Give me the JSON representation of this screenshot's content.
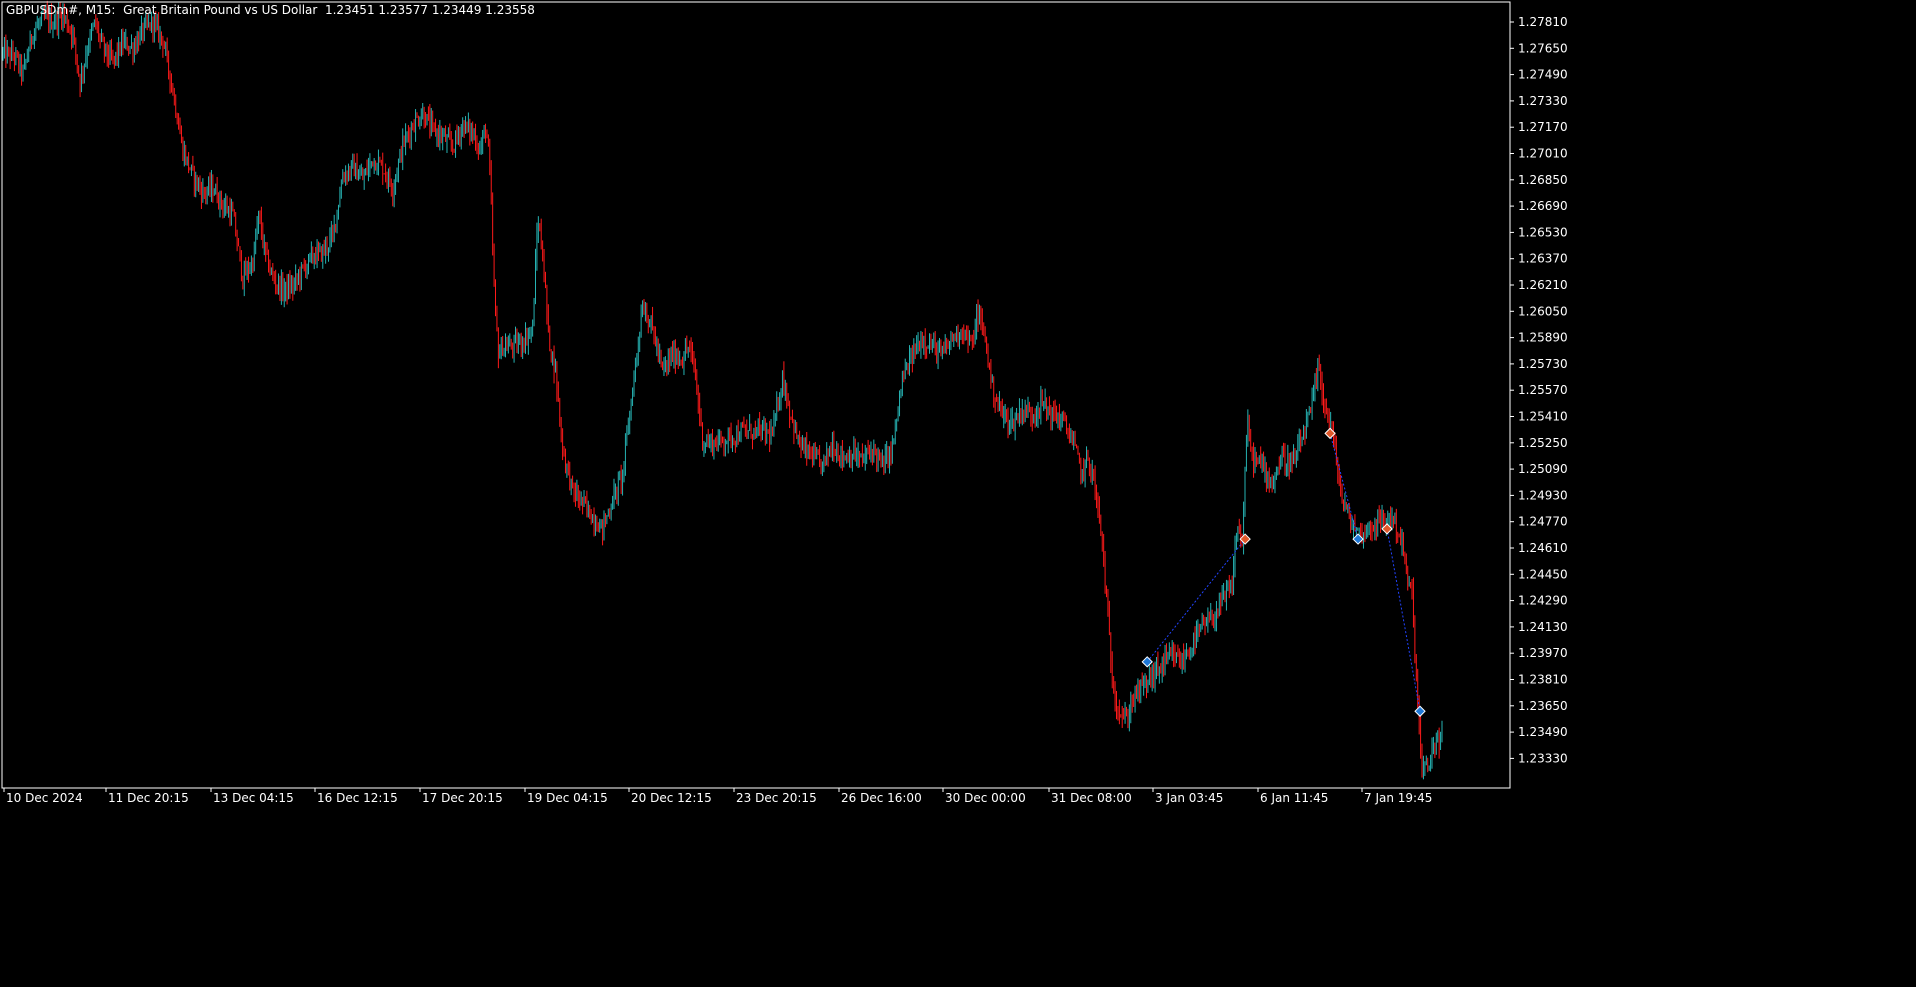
{
  "window": {
    "symbol": "GBPUSDm#",
    "timeframe": "M15",
    "description": "Great Britain Pound vs US Dollar",
    "ohlc": [
      "1.23451",
      "1.23577",
      "1.23449",
      "1.23558"
    ],
    "title_text": "GBPUSDm#, M15:  Great Britain Pound vs US Dollar  1.23451 1.23577 1.23449 1.23558"
  },
  "colors": {
    "background": "#000000",
    "frame": "#ffffff",
    "bull_candle": "#26b3b3",
    "bear_candle": "#ff1a1a",
    "marker_buy": "#1e78d7",
    "marker_sell": "#e0582a",
    "trade_line": "#2244ff",
    "text": "#ffffff"
  },
  "chart_data": {
    "type": "candlestick",
    "title": "GBPUSDm#, M15:  Great Britain Pound vs US Dollar",
    "x_tick_labels": [
      "10 Dec 2024",
      "11 Dec 20:15",
      "13 Dec 04:15",
      "16 Dec 12:15",
      "17 Dec 20:15",
      "19 Dec 04:15",
      "20 Dec 12:15",
      "23 Dec 20:15",
      "26 Dec 16:00",
      "30 Dec 00:00",
      "31 Dec 08:00",
      "3 Jan 03:45",
      "6 Jan 11:45",
      "7 Jan 19:45"
    ],
    "y_tick_labels": [
      "1.27810",
      "1.27650",
      "1.27490",
      "1.27330",
      "1.27170",
      "1.27010",
      "1.26850",
      "1.26690",
      "1.26530",
      "1.26370",
      "1.26210",
      "1.26050",
      "1.25890",
      "1.25730",
      "1.25570",
      "1.25410",
      "1.25250",
      "1.25090",
      "1.24930",
      "1.24770",
      "1.24610",
      "1.24450",
      "1.24290",
      "1.24130",
      "1.23970",
      "1.23810",
      "1.23650",
      "1.23490",
      "1.23330"
    ],
    "ylim": [
      1.2326,
      1.2787
    ],
    "grid": false,
    "price_path": [
      [
        0.0,
        1.2757
      ],
      [
        1.2,
        1.2755
      ],
      [
        2.0,
        1.2745
      ],
      [
        3.0,
        1.277
      ],
      [
        4.2,
        1.2778
      ],
      [
        5.0,
        1.2775
      ],
      [
        6.0,
        1.278
      ],
      [
        7.0,
        1.2768
      ],
      [
        7.7,
        1.274
      ],
      [
        8.5,
        1.2762
      ],
      [
        9.2,
        1.2775
      ],
      [
        10.0,
        1.276
      ],
      [
        11.0,
        1.2752
      ],
      [
        12.0,
        1.2763
      ],
      [
        13.0,
        1.276
      ],
      [
        14.0,
        1.277
      ],
      [
        15.0,
        1.2775
      ],
      [
        16.0,
        1.2765
      ],
      [
        17.0,
        1.2735
      ],
      [
        18.0,
        1.27
      ],
      [
        19.0,
        1.2685
      ],
      [
        20.0,
        1.2675
      ],
      [
        21.0,
        1.2678
      ],
      [
        22.0,
        1.2668
      ],
      [
        23.0,
        1.2662
      ],
      [
        24.0,
        1.2625
      ],
      [
        25.0,
        1.2635
      ],
      [
        25.6,
        1.2662
      ],
      [
        26.2,
        1.264
      ],
      [
        27.0,
        1.2625
      ],
      [
        28.0,
        1.2618
      ],
      [
        29.0,
        1.262
      ],
      [
        30.0,
        1.263
      ],
      [
        31.0,
        1.2638
      ],
      [
        32.0,
        1.264
      ],
      [
        33.0,
        1.265
      ],
      [
        34.0,
        1.2685
      ],
      [
        35.0,
        1.269
      ],
      [
        36.0,
        1.2683
      ],
      [
        37.0,
        1.2695
      ],
      [
        38.0,
        1.269
      ],
      [
        39.0,
        1.2678
      ],
      [
        40.0,
        1.2703
      ],
      [
        41.0,
        1.2715
      ],
      [
        42.0,
        1.2722
      ],
      [
        43.0,
        1.2712
      ],
      [
        44.0,
        1.2708
      ],
      [
        45.0,
        1.2702
      ],
      [
        46.0,
        1.2715
      ],
      [
        47.0,
        1.271
      ],
      [
        47.8,
        1.27
      ],
      [
        48.3,
        1.2715
      ],
      [
        48.7,
        1.269
      ],
      [
        49.2,
        1.261
      ],
      [
        49.6,
        1.258
      ],
      [
        50.0,
        1.2585
      ],
      [
        51.0,
        1.2585
      ],
      [
        52.0,
        1.2588
      ],
      [
        53.0,
        1.2595
      ],
      [
        53.5,
        1.266
      ],
      [
        54.0,
        1.264
      ],
      [
        54.6,
        1.259
      ],
      [
        55.3,
        1.257
      ],
      [
        56.0,
        1.2525
      ],
      [
        57.0,
        1.25
      ],
      [
        58.0,
        1.2493
      ],
      [
        59.0,
        1.2485
      ],
      [
        60.0,
        1.2478
      ],
      [
        61.0,
        1.2495
      ],
      [
        62.0,
        1.251
      ],
      [
        63.0,
        1.256
      ],
      [
        64.0,
        1.261
      ],
      [
        65.0,
        1.2595
      ],
      [
        66.0,
        1.257
      ],
      [
        67.0,
        1.258
      ],
      [
        68.0,
        1.2578
      ],
      [
        68.6,
        1.2585
      ],
      [
        69.2,
        1.2572
      ],
      [
        70.0,
        1.253
      ],
      [
        71.0,
        1.2528
      ],
      [
        72.0,
        1.253
      ],
      [
        73.0,
        1.2532
      ],
      [
        74.0,
        1.2535
      ],
      [
        75.0,
        1.2535
      ],
      [
        76.0,
        1.2535
      ],
      [
        77.0,
        1.2533
      ],
      [
        78.0,
        1.2567
      ],
      [
        78.7,
        1.2548
      ],
      [
        79.5,
        1.253
      ],
      [
        80.0,
        1.2525
      ],
      [
        81.0,
        1.252
      ],
      [
        82.0,
        1.2515
      ],
      [
        83.0,
        1.2528
      ],
      [
        84.0,
        1.252
      ],
      [
        85.0,
        1.2522
      ],
      [
        86.0,
        1.2518
      ],
      [
        87.0,
        1.2525
      ],
      [
        88.0,
        1.2515
      ],
      [
        89.0,
        1.2525
      ],
      [
        90.0,
        1.2565
      ],
      [
        91.0,
        1.258
      ],
      [
        92.0,
        1.259
      ],
      [
        93.0,
        1.2585
      ],
      [
        94.0,
        1.258
      ],
      [
        95.0,
        1.259
      ],
      [
        96.0,
        1.2595
      ],
      [
        97.0,
        1.2585
      ],
      [
        97.5,
        1.2605
      ],
      [
        98.3,
        1.259
      ],
      [
        99.0,
        1.256
      ],
      [
        100.0,
        1.2545
      ],
      [
        101.0,
        1.254
      ],
      [
        102.0,
        1.2548
      ],
      [
        103.0,
        1.2545
      ],
      [
        104.0,
        1.2552
      ],
      [
        105.0,
        1.2545
      ],
      [
        106.0,
        1.2542
      ],
      [
        107.0,
        1.253
      ],
      [
        108.0,
        1.251
      ],
      [
        108.6,
        1.252
      ],
      [
        109.2,
        1.2505
      ],
      [
        110.0,
        1.247
      ],
      [
        110.5,
        1.243
      ],
      [
        111.0,
        1.239
      ],
      [
        111.6,
        1.2372
      ],
      [
        112.4,
        1.2365
      ],
      [
        113.0,
        1.2378
      ],
      [
        114.0,
        1.2385
      ],
      [
        115.0,
        1.2392
      ],
      [
        116.0,
        1.2398
      ],
      [
        117.0,
        1.2403
      ],
      [
        118.0,
        1.24
      ],
      [
        119.0,
        1.241
      ],
      [
        120.0,
        1.242
      ],
      [
        121.0,
        1.2425
      ],
      [
        122.0,
        1.2435
      ],
      [
        123.0,
        1.2445
      ],
      [
        123.5,
        1.248
      ],
      [
        124.0,
        1.247
      ],
      [
        124.5,
        1.254
      ],
      [
        125.0,
        1.252
      ],
      [
        126.0,
        1.2515
      ],
      [
        127.0,
        1.2505
      ],
      [
        128.0,
        1.252
      ],
      [
        129.0,
        1.2515
      ],
      [
        130.0,
        1.253
      ],
      [
        131.0,
        1.255
      ],
      [
        131.6,
        1.2573
      ],
      [
        132.3,
        1.255
      ],
      [
        133.0,
        1.2535
      ],
      [
        134.0,
        1.2495
      ],
      [
        135.0,
        1.248
      ],
      [
        136.0,
        1.2475
      ],
      [
        137.0,
        1.248
      ],
      [
        138.0,
        1.2482
      ],
      [
        139.0,
        1.2485
      ],
      [
        140.0,
        1.247
      ],
      [
        140.6,
        1.2445
      ],
      [
        141.0,
        1.244
      ],
      [
        141.5,
        1.2382
      ],
      [
        142.0,
        1.2335
      ],
      [
        142.6,
        1.2338
      ],
      [
        143.2,
        1.2352
      ],
      [
        144.0,
        1.2355
      ]
    ],
    "trade_markers": [
      {
        "bar": 114.5,
        "price": 1.24,
        "side": "buy"
      },
      {
        "bar": 124.3,
        "price": 1.2472,
        "side": "sell"
      },
      {
        "bar": 132.8,
        "price": 1.2534,
        "side": "sell"
      },
      {
        "bar": 135.6,
        "price": 1.2472,
        "side": "buy"
      },
      {
        "bar": 138.5,
        "price": 1.2478,
        "side": "sell"
      },
      {
        "bar": 141.8,
        "price": 1.2371,
        "side": "buy"
      }
    ],
    "trade_lines": [
      {
        "from_bar": 114.5,
        "from_price": 1.24,
        "to_bar": 124.3,
        "to_price": 1.2472
      },
      {
        "from_bar": 132.8,
        "from_price": 1.2534,
        "to_bar": 135.6,
        "to_price": 1.2472
      },
      {
        "from_bar": 138.5,
        "from_price": 1.2478,
        "to_bar": 141.8,
        "to_price": 1.2371
      }
    ],
    "last_bar": 144.0
  }
}
